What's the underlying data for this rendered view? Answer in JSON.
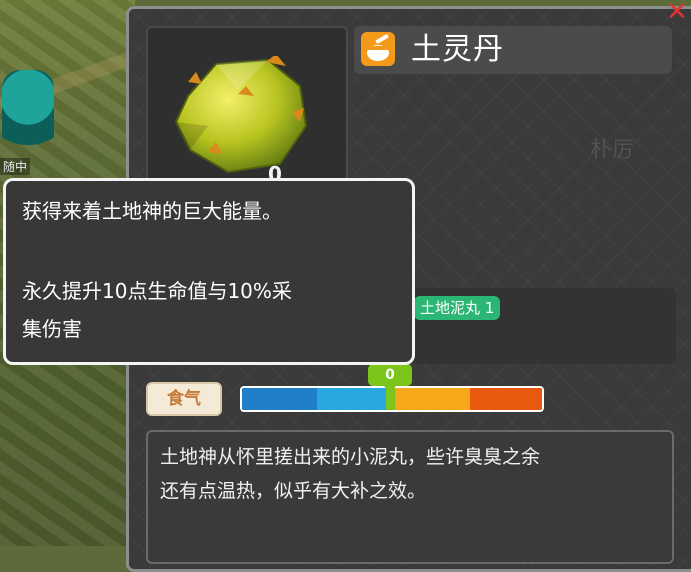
{
  "background": {
    "npc_label": "随中"
  },
  "item": {
    "name": "土灵丹",
    "quantity": "0",
    "watermark": "朴厉"
  },
  "recipe": {
    "tag": "土地泥丸 1"
  },
  "food_qi": {
    "label": "食气",
    "value": "0",
    "segment_colors": [
      "#1f7fc8",
      "#29a8e0",
      "#f6b21a",
      "#f7a11c",
      "#e85a10"
    ]
  },
  "description": "土地神从怀里搓出来的小泥丸，些许臭臭之余\n还有点温热，似乎有大补之效。",
  "tooltip": {
    "line1": "获得来着土地神的巨大能量。",
    "line2": "永久提升10点生命值与10%采",
    "line3": "集伤害"
  },
  "colors": {
    "accent_green": "#7cc51a",
    "recipe_green": "#2bb673",
    "close_red": "#e03434"
  }
}
